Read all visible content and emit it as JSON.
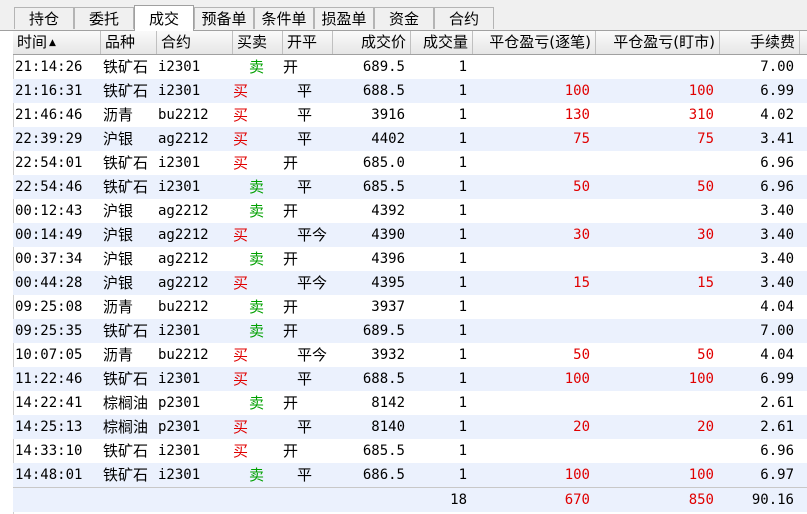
{
  "tabs": [
    {
      "label": "持仓",
      "active": false
    },
    {
      "label": "委托",
      "active": false
    },
    {
      "label": "成交",
      "active": true
    },
    {
      "label": "预备单",
      "active": false
    },
    {
      "label": "条件单",
      "active": false
    },
    {
      "label": "损盈单",
      "active": false
    },
    {
      "label": "资金",
      "active": false
    },
    {
      "label": "合约",
      "active": false
    }
  ],
  "columns": {
    "time": "时间",
    "product": "品种",
    "contract": "合约",
    "side": "买卖",
    "open_close": "开平",
    "price": "成交价",
    "volume": "成交量",
    "pnl_daily": "平仓盈亏(逐笔)",
    "pnl_mtm": "平仓盈亏(盯市)",
    "fee": "手续费"
  },
  "sort_indicator": "▲",
  "colors": {
    "buy": "#e00000",
    "sell": "#00a000",
    "stripe": "#ebf1fd"
  },
  "rows": [
    {
      "time": "21:14:26",
      "product": "铁矿石",
      "contract": "i2301",
      "side": "卖",
      "open_close": "开",
      "price": "689.5",
      "volume": "1",
      "pnl_daily": "",
      "pnl_mtm": "",
      "fee": "7.00"
    },
    {
      "time": "21:16:31",
      "product": "铁矿石",
      "contract": "i2301",
      "side": "买",
      "open_close": "平",
      "price": "688.5",
      "volume": "1",
      "pnl_daily": "100",
      "pnl_mtm": "100",
      "fee": "6.99"
    },
    {
      "time": "21:46:46",
      "product": "沥青",
      "contract": "bu2212",
      "side": "买",
      "open_close": "平",
      "price": "3916",
      "volume": "1",
      "pnl_daily": "130",
      "pnl_mtm": "310",
      "fee": "4.02"
    },
    {
      "time": "22:39:29",
      "product": "沪银",
      "contract": "ag2212",
      "side": "买",
      "open_close": "平",
      "price": "4402",
      "volume": "1",
      "pnl_daily": "75",
      "pnl_mtm": "75",
      "fee": "3.41"
    },
    {
      "time": "22:54:01",
      "product": "铁矿石",
      "contract": "i2301",
      "side": "买",
      "open_close": "开",
      "price": "685.0",
      "volume": "1",
      "pnl_daily": "",
      "pnl_mtm": "",
      "fee": "6.96"
    },
    {
      "time": "22:54:46",
      "product": "铁矿石",
      "contract": "i2301",
      "side": "卖",
      "open_close": "平",
      "price": "685.5",
      "volume": "1",
      "pnl_daily": "50",
      "pnl_mtm": "50",
      "fee": "6.96"
    },
    {
      "time": "00:12:43",
      "product": "沪银",
      "contract": "ag2212",
      "side": "卖",
      "open_close": "开",
      "price": "4392",
      "volume": "1",
      "pnl_daily": "",
      "pnl_mtm": "",
      "fee": "3.40"
    },
    {
      "time": "00:14:49",
      "product": "沪银",
      "contract": "ag2212",
      "side": "买",
      "open_close": "平今",
      "price": "4390",
      "volume": "1",
      "pnl_daily": "30",
      "pnl_mtm": "30",
      "fee": "3.40"
    },
    {
      "time": "00:37:34",
      "product": "沪银",
      "contract": "ag2212",
      "side": "卖",
      "open_close": "开",
      "price": "4396",
      "volume": "1",
      "pnl_daily": "",
      "pnl_mtm": "",
      "fee": "3.40"
    },
    {
      "time": "00:44:28",
      "product": "沪银",
      "contract": "ag2212",
      "side": "买",
      "open_close": "平今",
      "price": "4395",
      "volume": "1",
      "pnl_daily": "15",
      "pnl_mtm": "15",
      "fee": "3.40"
    },
    {
      "time": "09:25:08",
      "product": "沥青",
      "contract": "bu2212",
      "side": "卖",
      "open_close": "开",
      "price": "3937",
      "volume": "1",
      "pnl_daily": "",
      "pnl_mtm": "",
      "fee": "4.04"
    },
    {
      "time": "09:25:35",
      "product": "铁矿石",
      "contract": "i2301",
      "side": "卖",
      "open_close": "开",
      "price": "689.5",
      "volume": "1",
      "pnl_daily": "",
      "pnl_mtm": "",
      "fee": "7.00"
    },
    {
      "time": "10:07:05",
      "product": "沥青",
      "contract": "bu2212",
      "side": "买",
      "open_close": "平今",
      "price": "3932",
      "volume": "1",
      "pnl_daily": "50",
      "pnl_mtm": "50",
      "fee": "4.04"
    },
    {
      "time": "11:22:46",
      "product": "铁矿石",
      "contract": "i2301",
      "side": "买",
      "open_close": "平",
      "price": "688.5",
      "volume": "1",
      "pnl_daily": "100",
      "pnl_mtm": "100",
      "fee": "6.99"
    },
    {
      "time": "14:22:41",
      "product": "棕榈油",
      "contract": "p2301",
      "side": "卖",
      "open_close": "开",
      "price": "8142",
      "volume": "1",
      "pnl_daily": "",
      "pnl_mtm": "",
      "fee": "2.61"
    },
    {
      "time": "14:25:13",
      "product": "棕榈油",
      "contract": "p2301",
      "side": "买",
      "open_close": "平",
      "price": "8140",
      "volume": "1",
      "pnl_daily": "20",
      "pnl_mtm": "20",
      "fee": "2.61"
    },
    {
      "time": "14:33:10",
      "product": "铁矿石",
      "contract": "i2301",
      "side": "买",
      "open_close": "开",
      "price": "685.5",
      "volume": "1",
      "pnl_daily": "",
      "pnl_mtm": "",
      "fee": "6.96"
    },
    {
      "time": "14:48:01",
      "product": "铁矿石",
      "contract": "i2301",
      "side": "卖",
      "open_close": "平",
      "price": "686.5",
      "volume": "1",
      "pnl_daily": "100",
      "pnl_mtm": "100",
      "fee": "6.97"
    }
  ],
  "totals": {
    "volume": "18",
    "pnl_daily": "670",
    "pnl_mtm": "850",
    "fee": "90.16"
  }
}
